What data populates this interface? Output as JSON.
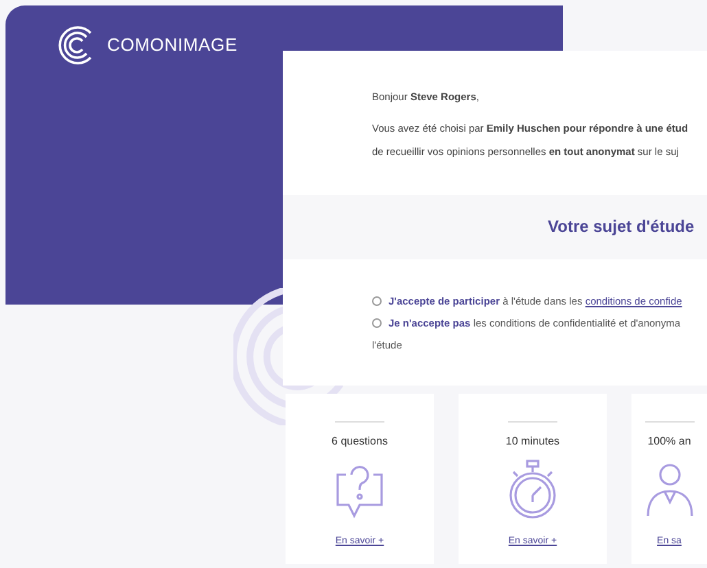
{
  "brand": {
    "name": "COMONIMAGE"
  },
  "greeting": "Bonjour **Steve Rogers**,",
  "intro": [
    "Vous avez été choisi par **Emily Huschen pour répondre à une étud**",
    "de recueillir vos opinions personnelles **en tout anonymat** sur le suj"
  ],
  "section_title": "Votre sujet d'étude",
  "consent_options": [
    {
      "accent": "J'accepte de participer",
      "text": "à l'étude dans les",
      "link": "conditions de confide",
      "selected": false
    },
    {
      "accent": "Je n'accepte pas",
      "text": "les conditions de confidentialité et d'anonyma",
      "selected": false
    }
  ],
  "consent_continuation": "l'étude",
  "features": [
    {
      "kind": "question",
      "title": "6 questions",
      "link": "En savoir +"
    },
    {
      "kind": "stopwatch",
      "title": "10 minutes",
      "link": "En savoir +"
    },
    {
      "kind": "person",
      "title": "100% an",
      "link": "En sa"
    }
  ]
}
